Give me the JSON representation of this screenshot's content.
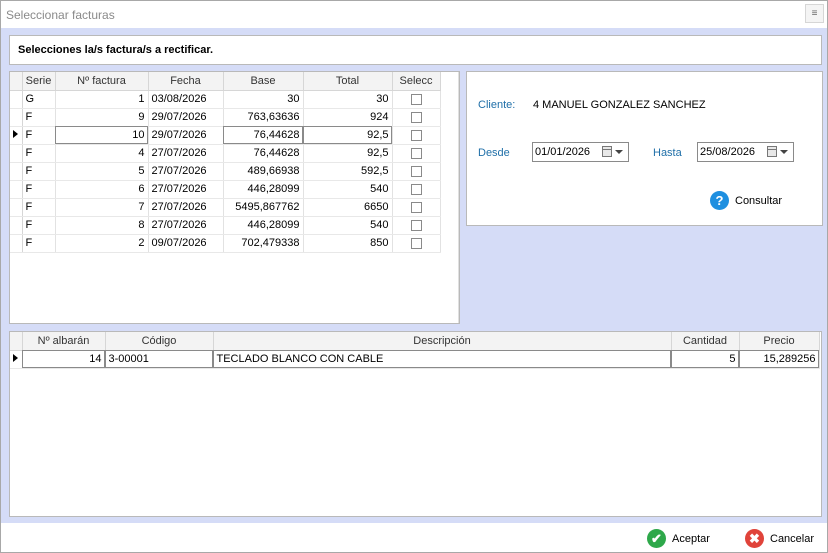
{
  "window": {
    "title": "Seleccionar facturas",
    "title_button": "≡"
  },
  "header": {
    "text": "Selecciones la/s factura/s a rectificar."
  },
  "invoices": {
    "columns": [
      "Serie",
      "Nº factura",
      "Fecha",
      "Base",
      "Total",
      "Selecc"
    ],
    "rows": [
      {
        "serie": "G",
        "numero": "1",
        "fecha": "03/08/2026",
        "base": "30",
        "total": "30",
        "selected": false
      },
      {
        "serie": "F",
        "numero": "9",
        "fecha": "29/07/2026",
        "base": "763,63636",
        "total": "924",
        "selected": false
      },
      {
        "serie": "F",
        "numero": "10",
        "fecha": "29/07/2026",
        "base": "76,44628",
        "total": "92,5",
        "selected": false
      },
      {
        "serie": "F",
        "numero": "4",
        "fecha": "27/07/2026",
        "base": "76,44628",
        "total": "92,5",
        "selected": false
      },
      {
        "serie": "F",
        "numero": "5",
        "fecha": "27/07/2026",
        "base": "489,66938",
        "total": "592,5",
        "selected": false
      },
      {
        "serie": "F",
        "numero": "6",
        "fecha": "27/07/2026",
        "base": "446,28099",
        "total": "540",
        "selected": false
      },
      {
        "serie": "F",
        "numero": "7",
        "fecha": "27/07/2026",
        "base": "5495,867762",
        "total": "6650",
        "selected": false
      },
      {
        "serie": "F",
        "numero": "8",
        "fecha": "27/07/2026",
        "base": "446,28099",
        "total": "540",
        "selected": false
      },
      {
        "serie": "F",
        "numero": "2",
        "fecha": "09/07/2026",
        "base": "702,479338",
        "total": "850",
        "selected": false
      }
    ],
    "current_row": 2
  },
  "filter": {
    "cliente_label": "Cliente:",
    "cliente_value": "4 MANUEL GONZALEZ SANCHEZ",
    "desde_label": "Desde",
    "desde_value": "01/01/2026",
    "hasta_label": "Hasta",
    "hasta_value": "25/08/2026",
    "consultar_label": "Consultar",
    "help_glyph": "?"
  },
  "lines": {
    "columns": [
      "Nº albarán",
      "Código",
      "Descripción",
      "Cantidad",
      "Precio"
    ],
    "rows": [
      {
        "albaran": "14",
        "codigo": "3-00001",
        "descripcion": "TECLADO BLANCO CON CABLE",
        "cantidad": "5",
        "precio": "15,289256"
      }
    ]
  },
  "footer": {
    "accept_label": "Aceptar",
    "cancel_label": "Cancelar",
    "accept_glyph": "✔",
    "cancel_glyph": "✖"
  },
  "colors": {
    "accent_blue": "#1f6fa8",
    "panel_bg": "#d5dcf7",
    "accept_green": "#2ea84a",
    "cancel_red": "#e0433a"
  }
}
